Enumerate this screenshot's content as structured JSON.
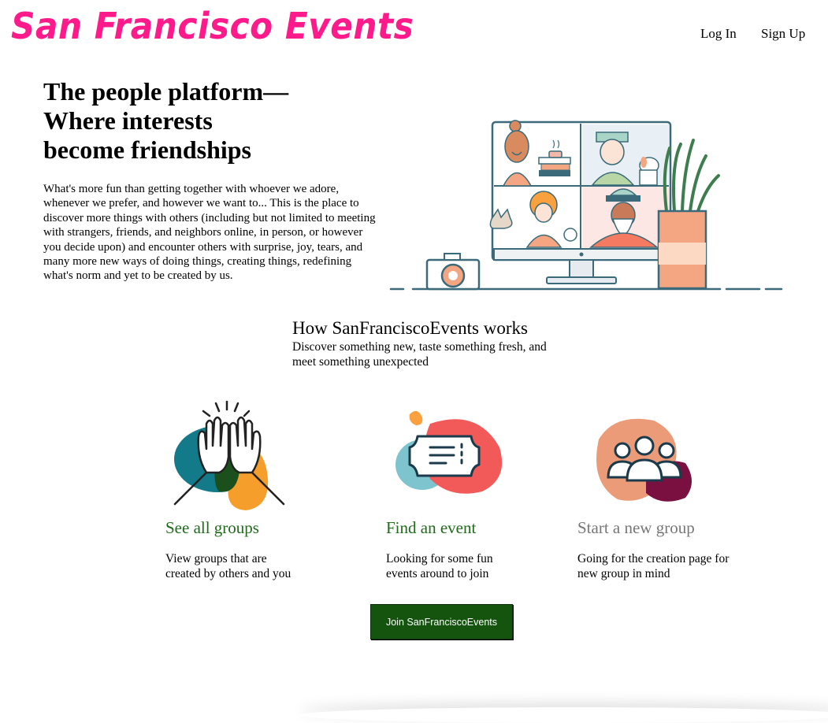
{
  "header": {
    "logo": "San Francisco Events",
    "login": "Log In",
    "signup": "Sign Up"
  },
  "hero": {
    "title_lines": [
      "The people platform—",
      "Where interests",
      "become friendships"
    ],
    "body": "What's more fun than getting together with whoever we adore, whenever we prefer, and however we want to... This is the place to discover more things with others (including but not limited to meeting with strangers, friends, and neighbors online, in person, or however you decide upon) and encounter others with surprise, joy, tears, and many more new ways of doing things, creating things, redefining what's norm and yet to be created by us."
  },
  "how": {
    "title": "How SanFranciscoEvents works",
    "subtitle": "Discover something new, taste something fresh, and meet something unexpected"
  },
  "cards": [
    {
      "title": "See all groups",
      "description": "View groups that are created by others and you",
      "icon": "high-five-icon"
    },
    {
      "title": "Find an event",
      "description": "Looking for some fun events around to join",
      "icon": "ticket-icon"
    },
    {
      "title": "Start a new group",
      "description": "Going for the creation page for new group in mind",
      "icon": "people-group-icon"
    }
  ],
  "cta": {
    "label": "Join SanFranciscoEvents"
  },
  "colors": {
    "brand_pink": "#ff1a8c",
    "link_green": "#1f6b1a",
    "muted_gray": "#777777",
    "button_green": "#14540f"
  }
}
